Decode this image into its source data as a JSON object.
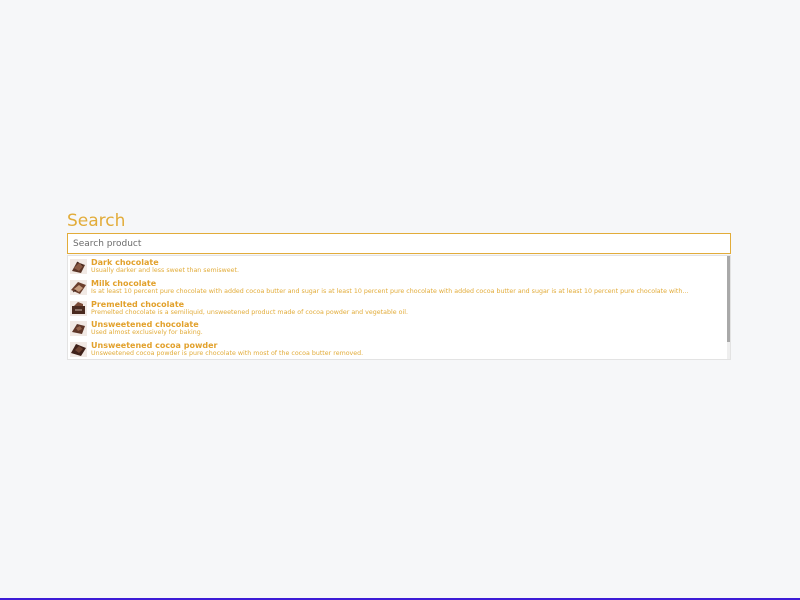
{
  "search": {
    "title": "Search",
    "placeholder": "Search product",
    "value": ""
  },
  "results": [
    {
      "name": "Dark chocolate",
      "description": "Usually darker and less sweet than semisweet.",
      "icon": "chocolate-thumbnail-icon"
    },
    {
      "name": "Milk chocolate",
      "description": "Is at least 10 percent pure chocolate with added cocoa butter and sugar is at least 10 percent pure chocolate with added cocoa butter and sugar is at least 10 percent pure chocolate with add...",
      "icon": "chocolate-thumbnail-icon"
    },
    {
      "name": "Premelted chocolate",
      "description": "Premelted chocolate is a semiliquid, unsweetened product made of cocoa powder and vegetable oil.",
      "icon": "chocolate-thumbnail-icon"
    },
    {
      "name": "Unsweetened chocolate",
      "description": "Used almost exclusively for baking.",
      "icon": "chocolate-thumbnail-icon"
    },
    {
      "name": "Unsweetened cocoa powder",
      "description": "Unsweetened cocoa powder is pure chocolate with most of the cocoa butter removed.",
      "icon": "chocolate-thumbnail-icon"
    }
  ],
  "colors": {
    "accent": "#e2ac3a",
    "background": "#f6f7f9",
    "bottom_bar": "#3d1bd6"
  }
}
